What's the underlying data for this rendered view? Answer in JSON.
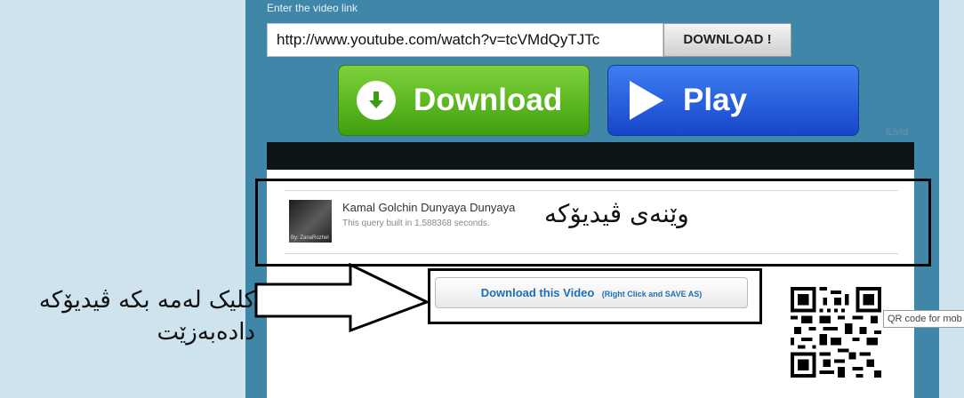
{
  "form": {
    "label": "Enter the video link",
    "url_value": "http://www.youtube.com/watch?v=tcVMdQyTJTc",
    "download_small_label": "DOWNLOAD !"
  },
  "buttons": {
    "download_label": "Download",
    "play_label": "Play",
    "brand": "iLivid"
  },
  "result": {
    "title": "Kamal Golchin Dunyaya Dunyaya",
    "subtitle": "This query built in 1.588368 seconds.",
    "thumb_text": "By: ZanaRozhel",
    "download_video_label": "Download this Video",
    "download_video_hint": "(Right Click and SAVE AS)",
    "qr_tooltip": "QR code for mob"
  },
  "annotations": {
    "thumbnail_note": "وێنەی ڤیدیۆکە",
    "click_note_line1": "کلیک لەمە بکە ڤیدیۆکە",
    "click_note_line2": "دادەبەزێت"
  },
  "colors": {
    "panel": "#3f86a8",
    "page_bg": "#cfe3ee",
    "download_green": "#4fae1a",
    "play_blue": "#2a5fdc",
    "link_blue": "#1e6fb6"
  },
  "icons": [
    "download-arrow-icon",
    "play-triangle-icon",
    "qr-code-icon"
  ]
}
